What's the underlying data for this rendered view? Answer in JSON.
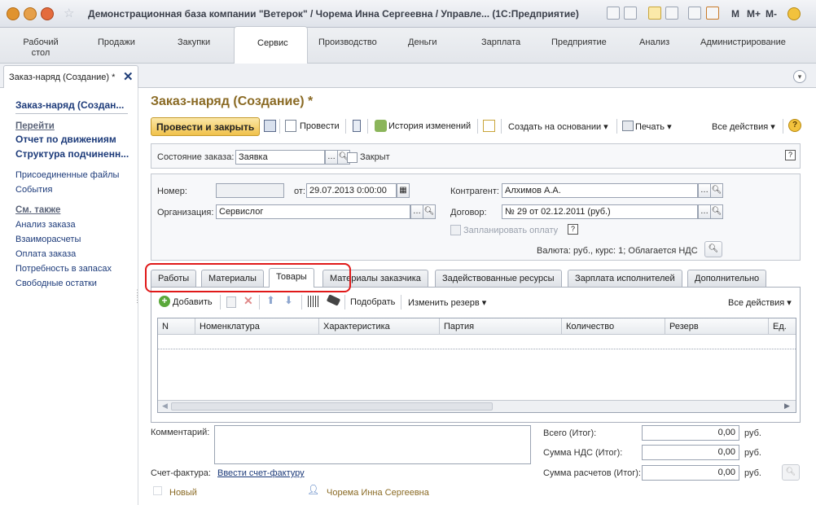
{
  "window": {
    "title": "Демонстрационная база компании \"Ветерок\" / Чорема Инна Сергеевна / Управле...  (1С:Предприятие)",
    "m_labels": [
      "M",
      "M+",
      "M-"
    ],
    "accent_color": "#f0c14b"
  },
  "sections": [
    "Рабочий стол",
    "Продажи",
    "Закупки",
    "Сервис",
    "Производство",
    "Деньги",
    "Зарплата",
    "Предприятие",
    "Анализ",
    "Администрирование"
  ],
  "open_tab": {
    "label": "Заказ-наряд (Создание) *"
  },
  "left_panel": {
    "current": "Заказ-наряд (Создан...",
    "goto_header": "Перейти",
    "goto_items": [
      "Отчет по движениям",
      "Структура подчиненн..."
    ],
    "links": [
      "Присоединенные файлы",
      "События"
    ],
    "see_also_header": "См. также",
    "see_also": [
      "Анализ заказа",
      "Взаиморасчеты",
      "Оплата заказа",
      "Потребность в запасах",
      "Свободные остатки"
    ]
  },
  "form": {
    "title": "Заказ-наряд (Создание) *",
    "toolbar": {
      "post_close": "Провести и закрыть",
      "post": "Провести",
      "history": "История изменений",
      "create_based": "Создать на основании",
      "print": "Печать",
      "all_actions": "Все действия"
    },
    "status_label": "Состояние заказа:",
    "status_value": "Заявка",
    "closed_label": "Закрыт",
    "number_label": "Номер:",
    "number_value": "",
    "date_label": "от:",
    "date_value": "29.07.2013  0:00:00",
    "org_label": "Организация:",
    "org_value": "Сервислог",
    "counterparty_label": "Контрагент:",
    "counterparty_value": "Алхимов А.А.",
    "contract_label": "Договор:",
    "contract_value": "№ 29 от 02.12.2011 (руб.)",
    "plan_payment_label": "Запланировать оплату",
    "currency_text": "Валюта: руб., курс: 1; Облагается НДС"
  },
  "tabs": [
    "Работы",
    "Материалы",
    "Товары",
    "Материалы заказчика",
    "Задействованные ресурсы",
    "Зарплата исполнителей",
    "Дополнительно"
  ],
  "active_tab": "Товары",
  "grid_toolbar": {
    "add": "Добавить",
    "pick": "Подобрать",
    "change_reserve": "Изменить резерв",
    "all_actions": "Все действия"
  },
  "grid": {
    "columns": [
      "N",
      "Номенклатура",
      "Характеристика",
      "Партия",
      "Количество",
      "Резерв",
      "Ед."
    ],
    "rows": []
  },
  "bottom": {
    "comment_label": "Комментарий:",
    "invoice_label": "Счет-фактура:",
    "invoice_link": "Ввести счет-фактуру",
    "new_label": "Новый",
    "author": "Чорема Инна Сергеевна",
    "total_label": "Всего (Итог):",
    "total_value": "0,00",
    "vat_label": "Сумма НДС (Итог):",
    "vat_value": "0,00",
    "settle_label": "Сумма расчетов (Итог):",
    "settle_value": "0,00",
    "currency": "руб."
  }
}
